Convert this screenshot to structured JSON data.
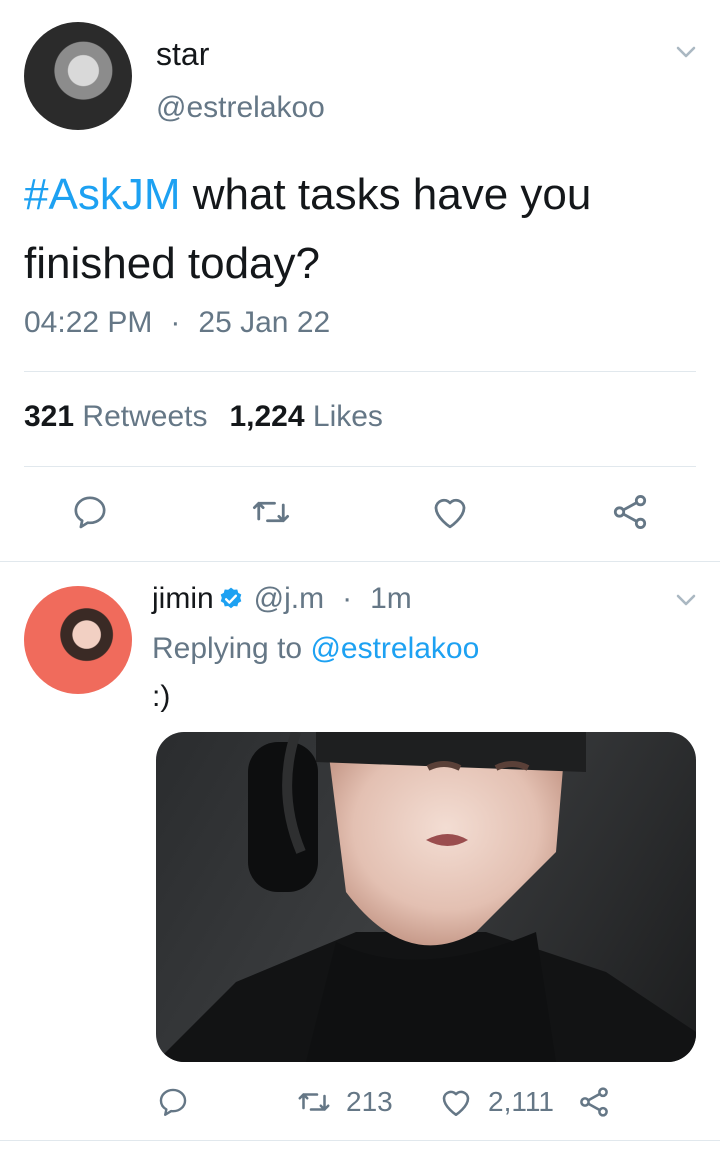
{
  "main_tweet": {
    "name": "star",
    "handle": "@estrelakoo",
    "hashtag": "#AskJM",
    "text": " what tasks have you finished today?",
    "time": "04:22 PM",
    "separator": "·",
    "date": "25 Jan 22",
    "retweets_count": "321",
    "retweets_label": "Retweets",
    "likes_count": "1,224",
    "likes_label": "Likes"
  },
  "reply_tweet": {
    "name": "jimin",
    "handle": "@j.m",
    "separator": "·",
    "time": "1m",
    "replying_prefix": "Replying to",
    "replying_to": "@estrelakoo",
    "text": ":)",
    "retweets_count": "213",
    "likes_count": "2,111"
  },
  "icons": {
    "reply": "reply-icon",
    "retweet": "retweet-icon",
    "like": "heart-icon",
    "share": "share-icon",
    "caret": "chevron-down-icon",
    "verified": "verified-badge-icon"
  },
  "colors": {
    "accent": "#1da1f2",
    "secondary_text": "#657786",
    "primary_text": "#14171a",
    "divider": "#e1e8ed"
  }
}
